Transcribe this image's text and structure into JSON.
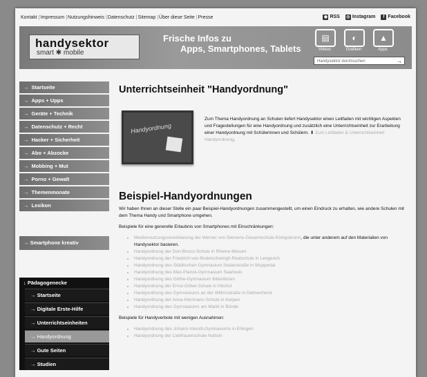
{
  "topbar": {
    "links": [
      "Kontakt",
      "Impressum",
      "Nutzungshinweis",
      "Datenschutz",
      "Sitemap",
      "Über diese Seite",
      "Presse"
    ],
    "social": [
      "RSS",
      "Instagram",
      "Facebook"
    ]
  },
  "header": {
    "logo_main": "handysektor",
    "logo_sub": "smart ✱ mobile",
    "tagline1": "Frische Infos zu",
    "tagline2": "Apps, Smartphones, Tablets",
    "buttons": [
      "Videos",
      "Grafiken",
      "Apps"
    ],
    "search_placeholder": "Handysektor durchsuchen"
  },
  "nav": [
    "Startseite",
    "Apps + Upps",
    "Geräte + Technik",
    "Datenschutz + Recht",
    "Hacker + Sicherheit",
    "Abo + Abzocke",
    "Mobbing + Mut",
    "Porno + Gewalt",
    "Themenmonate",
    "Lexikon"
  ],
  "kreativ": "Smartphone kreativ",
  "paed": {
    "header": "Pädagogenecke",
    "items": [
      "Startseite",
      "Digitale Erste-Hilfe",
      "Unterrichtseinheiten",
      "Handyordnung",
      "Gute Seiten",
      "Studien"
    ],
    "active_index": 3
  },
  "main": {
    "title": "Unterrichtseinheit \"Handyordnung\"",
    "board_text": "Handyordnung",
    "intro_text": "Zum Thema Handyordnung an Schulen liefert Handysektor einen Leitfaden mit wichtigen Aspekten und Fragestellungen für eine Handyordnung und zusätzlich eine Unterrichtseinheit zur Erarbeitung einer Handyordnung mit Schülerinnen und Schülern.",
    "intro_link": "Zum Leitfaden & Unterrichtseinheit Handyordnung",
    "section_title": "Beispiel-Handyordnungen",
    "section_intro": "Wir haben Ihnen an dieser Stelle ein paar Beispiel-Handyordnungen zusammengestellt, um einen Eindruck zu erhalten, wie andere Schulen mit dem Thema Handy und Smartphone umgehen.",
    "list1_title": "Beispiele für eine generelle Erlaubnis von Smartphones mit Einschränkungen:",
    "list1_first_link": "Mediennutzungsvereinbarung der Werner von Siemens-Gesamtschule Königsbronn",
    "list1_first_rest": ", die unter anderem auf den Materialien von Handysektor basieren.",
    "list1": [
      "Handyordnung der Don-Bosco-Schule in Rheine-Mesum",
      "Handyordnung der Friedrich-von-Bodelschwingh-Realschule in Lengerich",
      "Handyordnung des Städtischen Gymnasium Sedanstraße in Wuppertal",
      "Handyordnung des Max-Planck-Gymnasium Saarlouis",
      "Handyordnung des Göthe-Gymnasium Ibbenbüren",
      "Handyordnung der Ernst-Göbel-Schule in Höchst",
      "Handyordnung des Gymnasiums an der Willmsstraße in Delmenhorst",
      "Handyordnung der Anna-Herrmann-Schule in Kerpen",
      "Handyordnung des Gymnasiums am Markt in Bünde"
    ],
    "list2_title": "Beispiele für Handyverbote mit wenigen Ausnahmen:",
    "list2": [
      "Handyordnung des Johann-Vanotti-Gymnasiums in Ehingen",
      "Handyordnung der Liebfrauenschule Nottuln"
    ]
  }
}
